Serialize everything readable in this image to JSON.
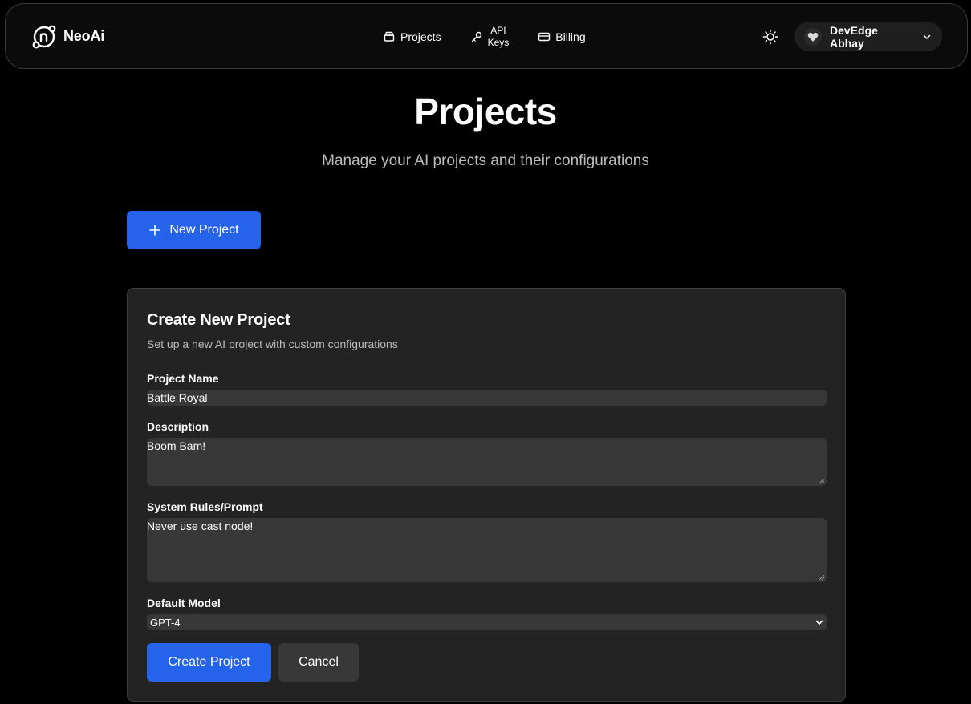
{
  "brand": {
    "name": "NeoAi",
    "logo_icon": "neoai-logo-icon"
  },
  "nav": {
    "projects_label": "Projects",
    "api_label_line1": "API",
    "api_label_line2": "Keys",
    "billing_label": "Billing"
  },
  "user": {
    "name": "DevEdge Abhay"
  },
  "page": {
    "title": "Projects",
    "subtitle": "Manage your AI projects and their configurations",
    "new_project_label": "New Project"
  },
  "form": {
    "title": "Create New Project",
    "description": "Set up a new AI project with custom configurations",
    "project_name_label": "Project Name",
    "project_name_value": "Battle Royal",
    "description_label": "Description",
    "description_value": "Boom Bam!",
    "system_rules_label": "System Rules/Prompt",
    "system_rules_value": "Never use cast node!",
    "default_model_label": "Default Model",
    "default_model_value": "GPT-4",
    "create_label": "Create Project",
    "cancel_label": "Cancel"
  },
  "colors": {
    "accent": "#2563eb",
    "background": "#000000",
    "card": "#232323",
    "input": "#383838"
  }
}
